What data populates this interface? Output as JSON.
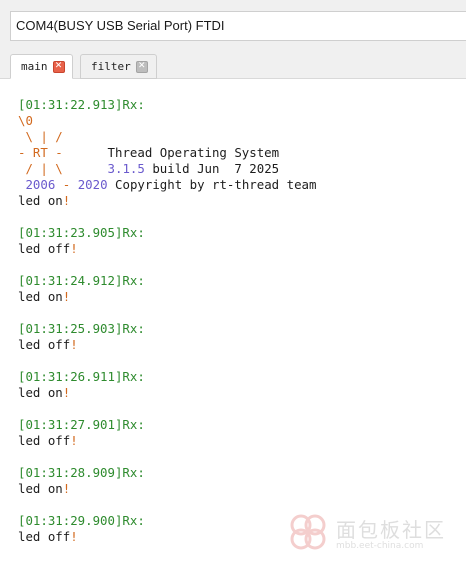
{
  "window": {
    "port_label": "COM4(BUSY  USB Serial Port) FTDI"
  },
  "tabs": [
    {
      "label": "main",
      "close_glyph": "✕",
      "active": true
    },
    {
      "label": "filter",
      "close_glyph": "✕",
      "active": false
    }
  ],
  "console": {
    "banner": {
      "timestamp": "[01:31:22.913]Rx:",
      "logo_lines": [
        "\\0",
        " \\ | /",
        "- RT -",
        " / | \\"
      ],
      "title": "Thread Operating System",
      "version": "3.1.5",
      "build": "build Jun  7 2025",
      "year_start": "2006",
      "year_sep": "-",
      "year_end": "2020",
      "copyright": "Copyright by rt-thread team",
      "led_text": "led on",
      "bang": "!"
    },
    "entries": [
      {
        "timestamp": "[01:31:23.905]Rx:",
        "text": "led off",
        "bang": "!"
      },
      {
        "timestamp": "[01:31:24.912]Rx:",
        "text": "led on",
        "bang": "!"
      },
      {
        "timestamp": "[01:31:25.903]Rx:",
        "text": "led off",
        "bang": "!"
      },
      {
        "timestamp": "[01:31:26.911]Rx:",
        "text": "led on",
        "bang": "!"
      },
      {
        "timestamp": "[01:31:27.901]Rx:",
        "text": "led off",
        "bang": "!"
      },
      {
        "timestamp": "[01:31:28.909]Rx:",
        "text": "led on",
        "bang": "!"
      },
      {
        "timestamp": "[01:31:29.900]Rx:",
        "text": "led off",
        "bang": "!"
      }
    ]
  },
  "watermark": {
    "text": "面包板社区",
    "url": "mbb.eet-china.com"
  },
  "colors": {
    "timestamp": "#2e8b2e",
    "logo": "#d2691e",
    "version": "#6a5acd",
    "active_close": "#e8624a"
  }
}
